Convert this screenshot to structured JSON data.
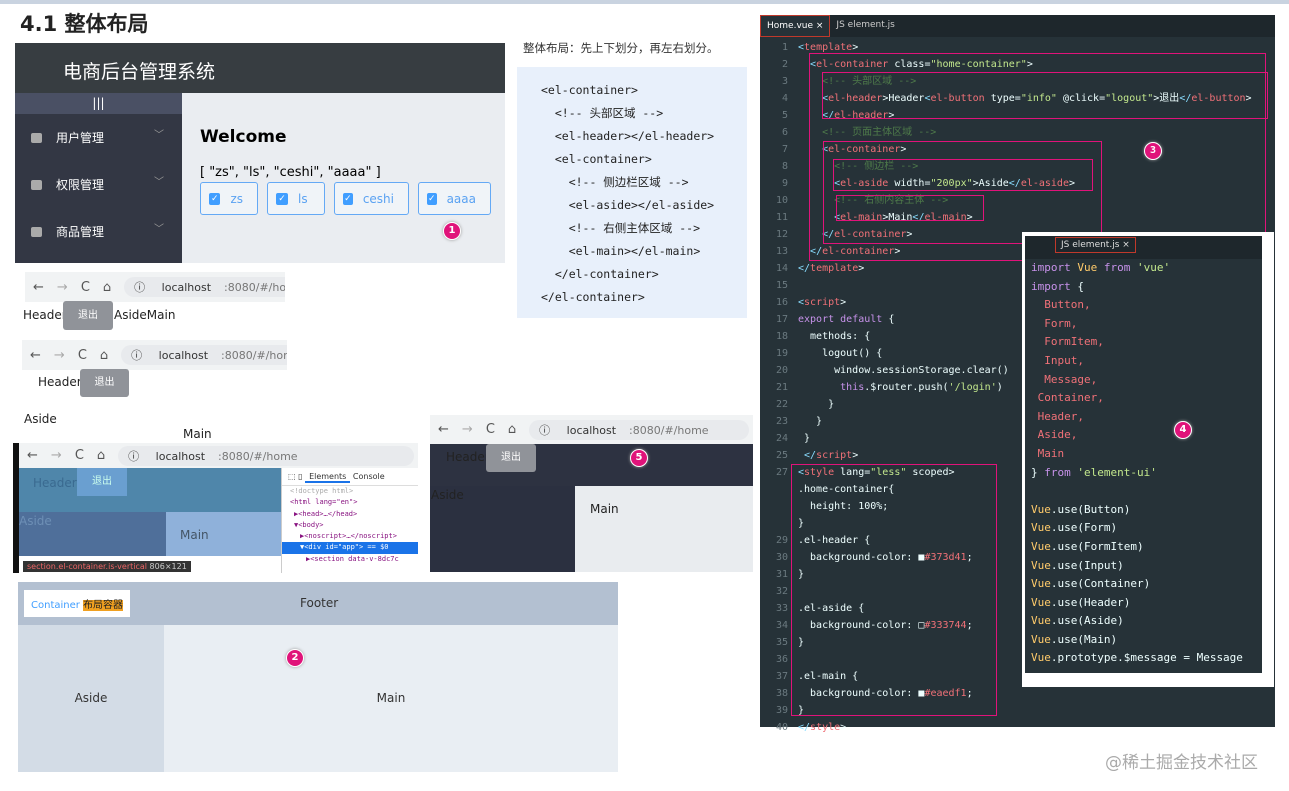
{
  "title": "4.1 整体布局",
  "panel1": {
    "app_title": "电商后台管理系统",
    "toggle": "|||",
    "menu": [
      "用户管理",
      "权限管理",
      "商品管理"
    ],
    "welcome": "Welcome",
    "array_text": "[ \"zs\", \"ls\", \"ceshi\", \"aaaa\" ]",
    "checkboxes": [
      "zs",
      "ls",
      "ceshi",
      "aaaa"
    ],
    "badge": "1"
  },
  "browser": {
    "back": "←",
    "forward": "→",
    "reload": "C",
    "home": "⌂",
    "info": "ⓘ",
    "host": "localhost",
    "path": ":8080/#/home"
  },
  "shotA": {
    "header": "Header",
    "logout": "退出",
    "rest": "AsideMain"
  },
  "shotB": {
    "header": "Header",
    "logout": "退出",
    "aside": "Aside",
    "main": "Main"
  },
  "shotC": {
    "header": "Header",
    "logout": "退出",
    "aside": "Aside",
    "main": "Main",
    "devtools_tabs": [
      "Elements",
      "Console"
    ],
    "dom": [
      "<!doctype html>",
      "<html lang=\"en\">",
      "▶<head>…</head>",
      "▼<body>",
      "▶<noscript>…</noscript>",
      "▼<div id=\"app\"> == $0",
      "▶<section data-v-8dc7c"
    ],
    "tooltip": "section.el-container.is-vertical",
    "tooltip_size": "806×121"
  },
  "shotD": {
    "header": "Header",
    "logout": "退出",
    "aside": "Aside",
    "main": "Main",
    "badge": "5"
  },
  "panel2": {
    "logo_a": "Container",
    "logo_b": "布局容器",
    "footer": "Footer",
    "aside": "Aside",
    "main": "Main",
    "badge": "2"
  },
  "desc": {
    "text": "整体布局：先上下划分，再左右划分。",
    "code": [
      "<el-container>",
      "  <!-- 头部区域 -->",
      "  <el-header></el-header>",
      "  <el-container>",
      "    <!-- 侧边栏区域 -->",
      "    <el-aside></el-aside>",
      "    <!-- 右侧主体区域 -->",
      "    <el-main></el-main>",
      "  </el-container>",
      "</el-container>"
    ]
  },
  "editor": {
    "tabs": [
      "Home.vue ×",
      "JS element.js"
    ],
    "badge": "3",
    "lines": [
      [
        "1",
        "<template>"
      ],
      [
        "2",
        "  <el-container class=\"home-container\">"
      ],
      [
        "3",
        "    <!-- 头部区域 -->"
      ],
      [
        "4",
        "    <el-header>Header<el-button type=\"info\" @click=\"logout\">退出</el-button>"
      ],
      [
        "5",
        "    </el-header>"
      ],
      [
        "6",
        "    <!-- 页面主体区域 -->"
      ],
      [
        "7",
        "    <el-container>"
      ],
      [
        "8",
        "      <!-- 侧边栏 -->"
      ],
      [
        "9",
        "      <el-aside width=\"200px\">Aside</el-aside>"
      ],
      [
        "10",
        "      <!-- 右侧内容主体 -->"
      ],
      [
        "11",
        "      <el-main>Main</el-main>"
      ],
      [
        "12",
        "    </el-container>"
      ],
      [
        "13",
        "  </el-container>"
      ],
      [
        "14",
        "</template>"
      ],
      [
        "15",
        ""
      ],
      [
        "16",
        "<script>"
      ],
      [
        "17",
        "export default {"
      ],
      [
        "18",
        "  methods: {"
      ],
      [
        "19",
        "    logout() {"
      ],
      [
        "20",
        "      window.sessionStorage.clear()"
      ],
      [
        "21",
        "       this.$router.push('/login')"
      ],
      [
        "22",
        "     }"
      ],
      [
        "23",
        "   }"
      ],
      [
        "24",
        " }"
      ],
      [
        "25",
        " </script>"
      ],
      [
        "27",
        "<style lang=\"less\" scoped>"
      ],
      [
        "",
        ".home-container{"
      ],
      [
        "",
        "  height: 100%;"
      ],
      [
        "",
        "}"
      ],
      [
        "29",
        ".el-header {"
      ],
      [
        "30",
        "  background-color: ■#373d41;"
      ],
      [
        "31",
        "}"
      ],
      [
        "32",
        ""
      ],
      [
        "33",
        ".el-aside {"
      ],
      [
        "34",
        "  background-color: □#333744;"
      ],
      [
        "35",
        "}"
      ],
      [
        "36",
        ""
      ],
      [
        "37",
        ".el-main {"
      ],
      [
        "38",
        "  background-color: ■#eaedf1;"
      ],
      [
        "39",
        "}"
      ],
      [
        "40",
        "</style>"
      ]
    ]
  },
  "elementjs": {
    "tab": "JS element.js ×",
    "badge": "4",
    "lines": [
      "import Vue from 'vue'",
      "import {",
      "  Button,",
      "  Form,",
      "  FormItem,",
      "  Input,",
      "  Message,",
      " Container,",
      " Header,",
      " Aside,",
      " Main",
      "} from 'element-ui'",
      "",
      "Vue.use(Button)",
      "Vue.use(Form)",
      "Vue.use(FormItem)",
      "Vue.use(Input)",
      "Vue.use(Container)",
      "Vue.use(Header)",
      "Vue.use(Aside)",
      "Vue.use(Main)",
      "Vue.prototype.$message = Message"
    ]
  },
  "watermark": "@稀土掘金技术社区"
}
